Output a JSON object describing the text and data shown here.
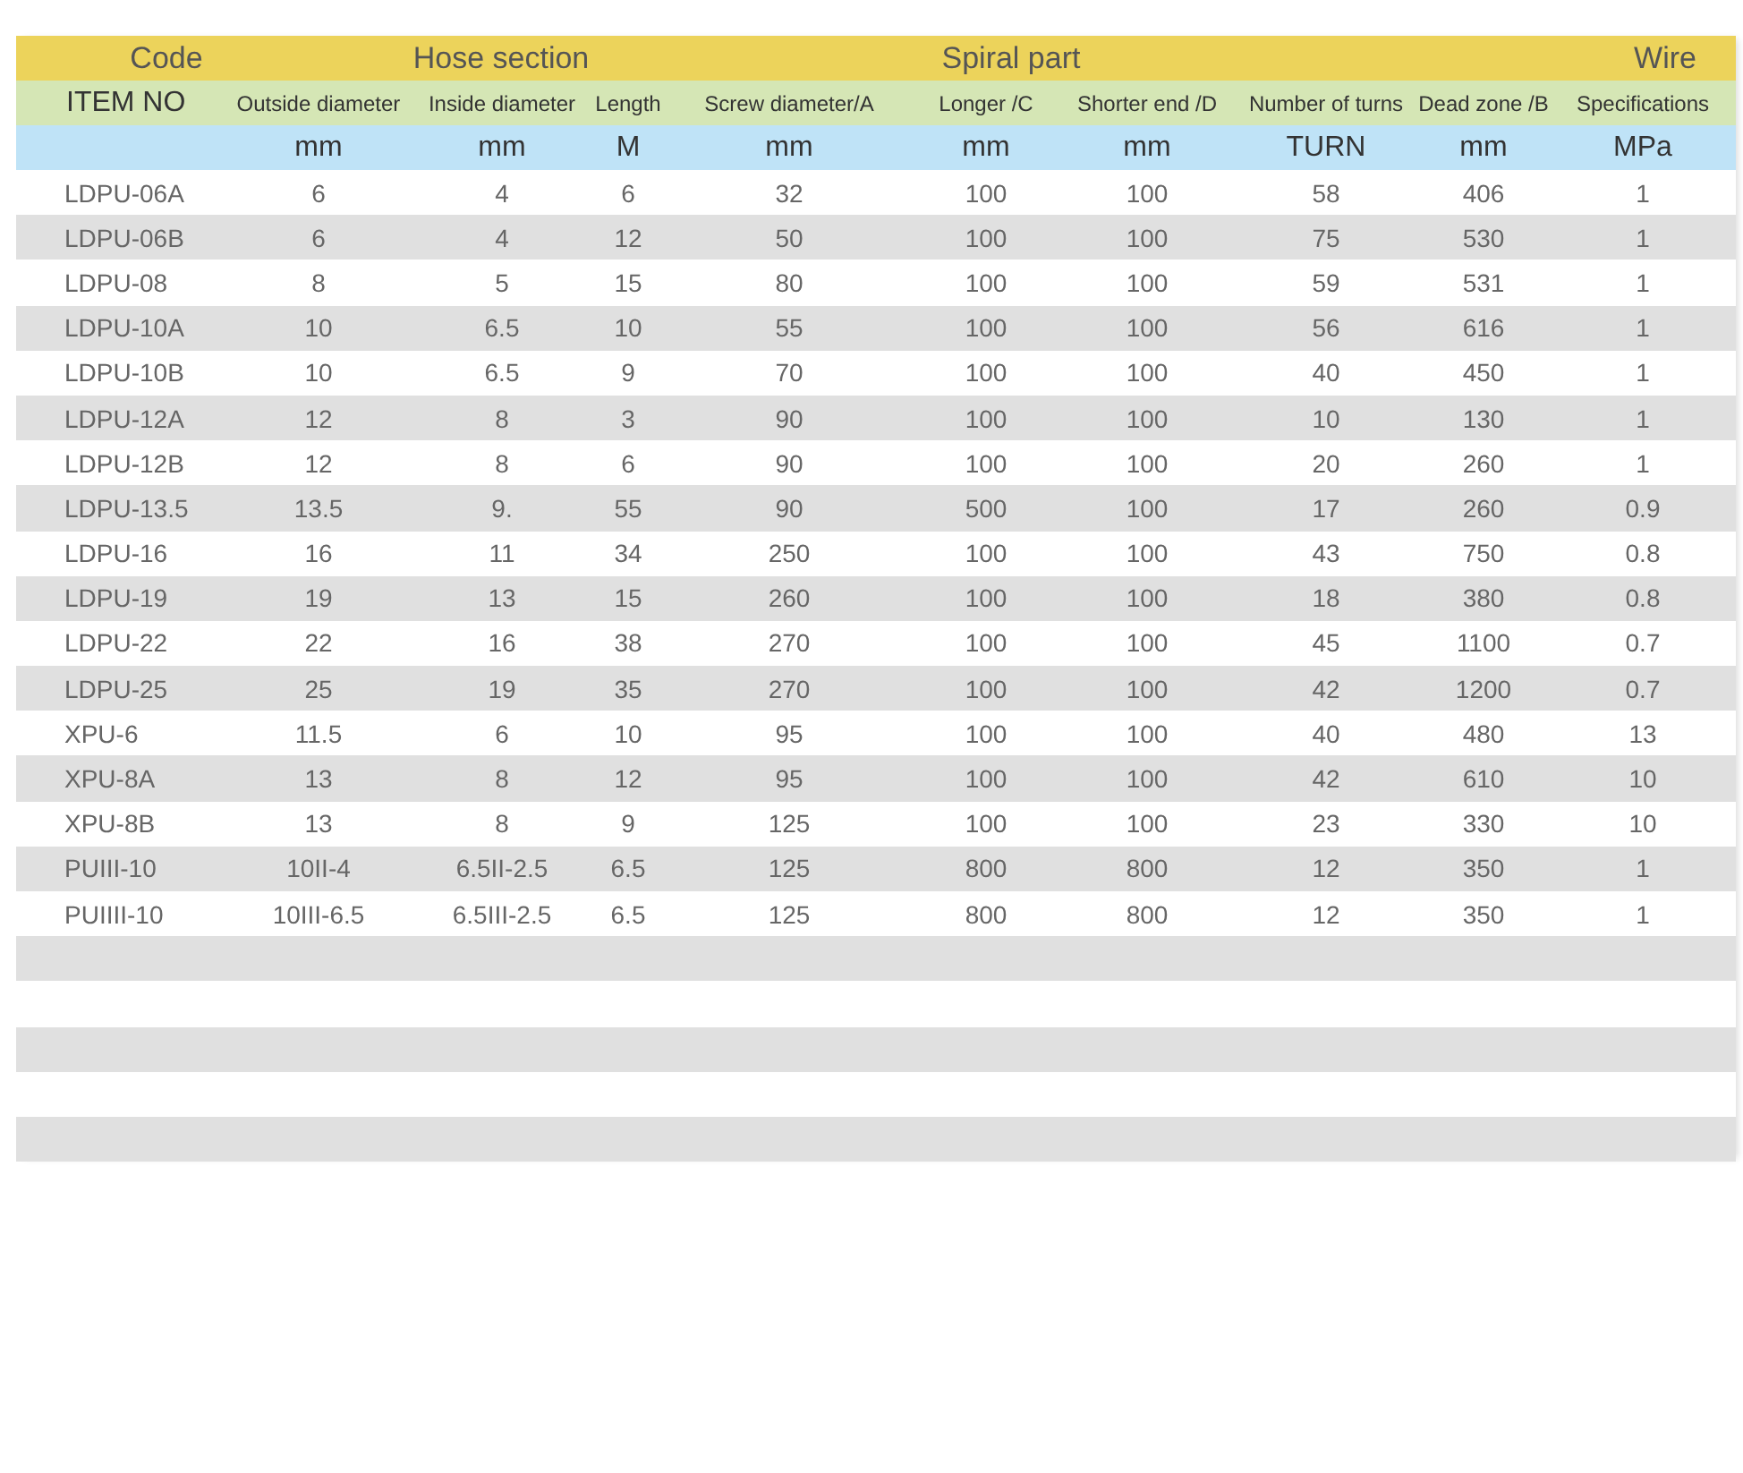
{
  "header_groups": [
    {
      "label": "Code"
    },
    {
      "label": "Hose section"
    },
    {
      "label": "Spiral part"
    },
    {
      "label": "Wire"
    }
  ],
  "columns": [
    {
      "label": "ITEM NO"
    },
    {
      "label": "Outside diameter",
      "unit": "mm"
    },
    {
      "label": "Inside diameter",
      "unit": "mm"
    },
    {
      "label": "Length",
      "unit": "M"
    },
    {
      "label": "Screw diameter/A",
      "unit": "mm"
    },
    {
      "label": "Longer /C",
      "unit": "mm"
    },
    {
      "label": "Shorter end /D",
      "unit": "mm"
    },
    {
      "label": "Number of turns",
      "unit": "TURN"
    },
    {
      "label": "Dead zone /B",
      "unit": "mm"
    },
    {
      "label": "Specifications",
      "unit": "MPa"
    }
  ],
  "rows": [
    [
      "LDPU-06A",
      "6",
      "4",
      "6",
      "32",
      "100",
      "100",
      "58",
      "406",
      "1"
    ],
    [
      "LDPU-06B",
      "6",
      "4",
      "12",
      "50",
      "100",
      "100",
      "75",
      "530",
      "1"
    ],
    [
      "LDPU-08",
      "8",
      "5",
      "15",
      "80",
      "100",
      "100",
      "59",
      "531",
      "1"
    ],
    [
      "LDPU-10A",
      "10",
      "6.5",
      "10",
      "55",
      "100",
      "100",
      "56",
      "616",
      "1"
    ],
    [
      "LDPU-10B",
      "10",
      "6.5",
      "9",
      "70",
      "100",
      "100",
      "40",
      "450",
      "1"
    ],
    [
      "LDPU-12A",
      "12",
      "8",
      "3",
      "90",
      "100",
      "100",
      "10",
      "130",
      "1"
    ],
    [
      "LDPU-12B",
      "12",
      "8",
      "6",
      "90",
      "100",
      "100",
      "20",
      "260",
      "1"
    ],
    [
      "LDPU-13.5",
      "13.5",
      "9.",
      "55",
      "90",
      "500",
      "100",
      "17",
      "260",
      "0.9"
    ],
    [
      "LDPU-16",
      "16",
      "11",
      "34",
      "250",
      "100",
      "100",
      "43",
      "750",
      "0.8"
    ],
    [
      "LDPU-19",
      "19",
      "13",
      "15",
      "260",
      "100",
      "100",
      "18",
      "380",
      "0.8"
    ],
    [
      "LDPU-22",
      "22",
      "16",
      "38",
      "270",
      "100",
      "100",
      "45",
      "1100",
      "0.7"
    ],
    [
      "LDPU-25",
      "25",
      "19",
      "35",
      "270",
      "100",
      "100",
      "42",
      "1200",
      "0.7"
    ],
    [
      "XPU-6",
      "11.5",
      "6",
      "10",
      "95",
      "100",
      "100",
      "40",
      "480",
      "13"
    ],
    [
      "XPU-8A",
      "13",
      "8",
      "12",
      "95",
      "100",
      "100",
      "42",
      "610",
      "10"
    ],
    [
      "XPU-8B",
      "13",
      "8",
      "9",
      "125",
      "100",
      "100",
      "23",
      "330",
      "10"
    ],
    [
      "PUIII-10",
      "10II-4",
      "6.5II-2.5",
      "6.5",
      "125",
      "800",
      "800",
      "12",
      "350",
      "1"
    ],
    [
      "PUIIII-10",
      "10III-6.5",
      "6.5III-2.5",
      "6.5",
      "125",
      "800",
      "800",
      "12",
      "350",
      "1"
    ]
  ]
}
